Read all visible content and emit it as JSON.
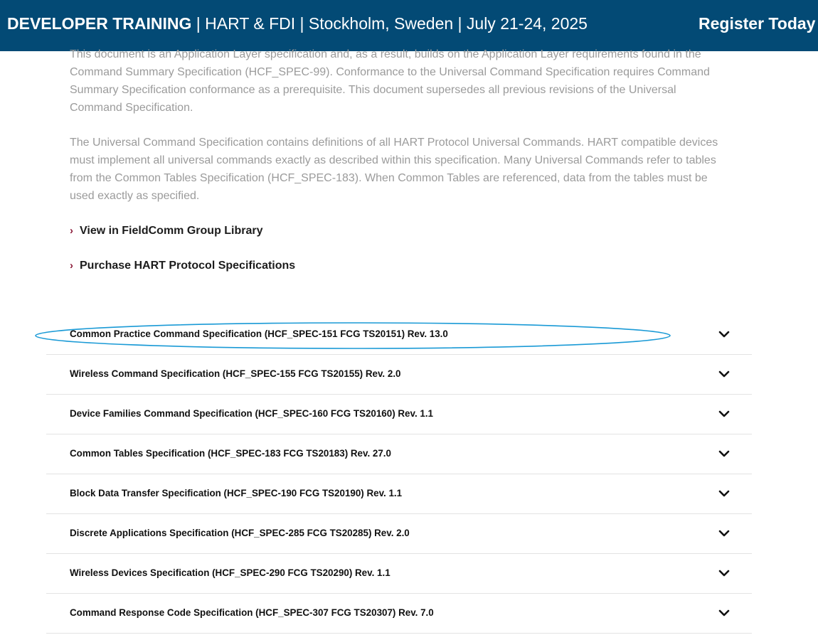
{
  "banner": {
    "title_strong": "DEVELOPER TRAINING",
    "title_rest": " | HART & FDI | Stockholm, Sweden | July 21-24, 2025",
    "register_label": "Register Today"
  },
  "intro": {
    "paragraph_1": "This document is an Application Layer specification and, as a result, builds on the Application Layer requirements found in the Command Summary Specification (HCF_SPEC-99). Conformance to the Universal Command Specification requires Command Summary Specification conformance as a prerequisite. This document supersedes all previous revisions of the Universal Command Specification.",
    "paragraph_2": "The Universal Command Specification contains definitions of all HART Protocol Universal Commands. HART compatible devices must implement all universal commands exactly as described within this specification. Many Universal Commands refer to tables from the Common Tables Specification (HCF_SPEC-183). When Common Tables are referenced, data from the tables must be used exactly as specified."
  },
  "links": [
    {
      "label": "View in FieldComm Group Library",
      "chevron": "›"
    },
    {
      "label": "Purchase HART Protocol Specifications",
      "chevron": "›"
    }
  ],
  "accordion": [
    {
      "label": "Common Practice Command Specification (HCF_SPEC-151 FCG TS20151) Rev. 13.0",
      "icon": "chevron-down-icon"
    },
    {
      "label": "Wireless Command Specification (HCF_SPEC-155 FCG TS20155) Rev. 2.0",
      "icon": "chevron-down-icon"
    },
    {
      "label": "Device Families Command Specification (HCF_SPEC-160 FCG TS20160) Rev. 1.1",
      "icon": "chevron-down-icon"
    },
    {
      "label": "Common Tables Specification (HCF_SPEC-183 FCG TS20183) Rev. 27.0",
      "icon": "chevron-down-icon"
    },
    {
      "label": "Block Data Transfer Specification (HCF_SPEC-190 FCG TS20190) Rev. 1.1",
      "icon": "chevron-down-icon"
    },
    {
      "label": "Discrete Applications Specification (HCF_SPEC-285 FCG TS20285) Rev. 2.0",
      "icon": "chevron-down-icon"
    },
    {
      "label": "Wireless Devices Specification (HCF_SPEC-290 FCG TS20290) Rev. 1.1",
      "icon": "chevron-down-icon"
    },
    {
      "label": "Command Response Code Specification (HCF_SPEC-307 FCG TS20307) Rev. 7.0",
      "icon": "chevron-down-icon"
    }
  ],
  "colors": {
    "banner_bg": "#034a75",
    "link_chevron": "#8c1c3a",
    "highlight_ellipse": "#1a9ad6",
    "paragraph_text": "#9b9b9b"
  }
}
